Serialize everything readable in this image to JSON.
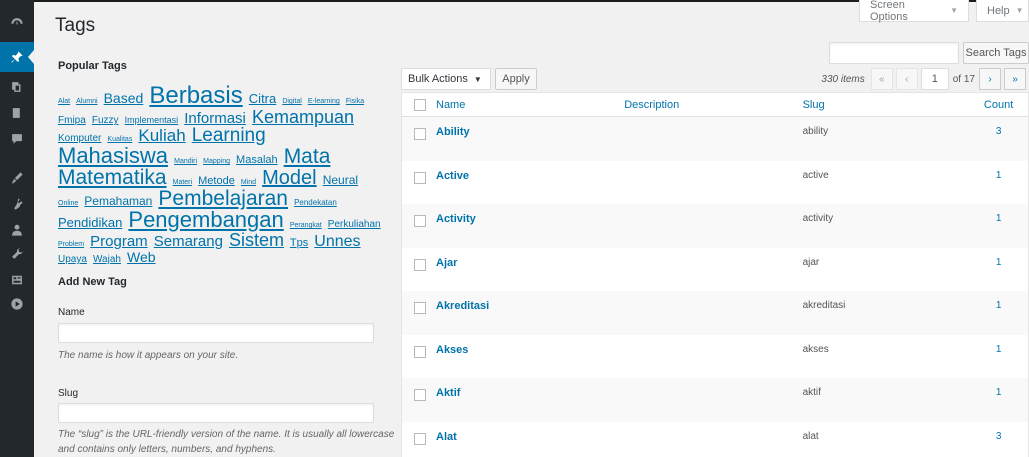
{
  "page_title": "Tags",
  "screen_meta": {
    "screen_options": "Screen Options",
    "help": "Help"
  },
  "search": {
    "button": "Search Tags",
    "value": ""
  },
  "popular_tags": {
    "title": "Popular Tags",
    "tags": [
      {
        "label": "Alat",
        "size": 7
      },
      {
        "label": "Alumni",
        "size": 7
      },
      {
        "label": "Based",
        "size": 14
      },
      {
        "label": "Berbasis",
        "size": 24
      },
      {
        "label": "Citra",
        "size": 13
      },
      {
        "label": "Digital",
        "size": 7
      },
      {
        "label": "E-learning",
        "size": 7
      },
      {
        "label": "Fisika",
        "size": 7
      },
      {
        "label": "Fmipa",
        "size": 10
      },
      {
        "label": "Fuzzy",
        "size": 10
      },
      {
        "label": "Implementasi",
        "size": 9
      },
      {
        "label": "Informasi",
        "size": 15
      },
      {
        "label": "Kemampuan",
        "size": 18
      },
      {
        "label": "Komputer",
        "size": 10
      },
      {
        "label": "Kualitas",
        "size": 7
      },
      {
        "label": "Kuliah",
        "size": 17
      },
      {
        "label": "Learning",
        "size": 19
      },
      {
        "label": "Mahasiswa",
        "size": 22
      },
      {
        "label": "Mandiri",
        "size": 7
      },
      {
        "label": "Mapping",
        "size": 7
      },
      {
        "label": "Masalah",
        "size": 11
      },
      {
        "label": "Mata",
        "size": 21
      },
      {
        "label": "Matematika",
        "size": 21
      },
      {
        "label": "Materi",
        "size": 7
      },
      {
        "label": "Metode",
        "size": 11
      },
      {
        "label": "Mind",
        "size": 7
      },
      {
        "label": "Model",
        "size": 20
      },
      {
        "label": "Neural",
        "size": 12
      },
      {
        "label": "Online",
        "size": 7
      },
      {
        "label": "Pemahaman",
        "size": 12
      },
      {
        "label": "Pembelajaran",
        "size": 21
      },
      {
        "label": "Pendekatan",
        "size": 8
      },
      {
        "label": "Pendidikan",
        "size": 13
      },
      {
        "label": "Pengembangan",
        "size": 22
      },
      {
        "label": "Perangkat",
        "size": 7
      },
      {
        "label": "Perkuliahan",
        "size": 10
      },
      {
        "label": "Problem",
        "size": 7
      },
      {
        "label": "Program",
        "size": 15
      },
      {
        "label": "Semarang",
        "size": 15
      },
      {
        "label": "Sistem",
        "size": 18
      },
      {
        "label": "Tps",
        "size": 11
      },
      {
        "label": "Unnes",
        "size": 16
      },
      {
        "label": "Upaya",
        "size": 10
      },
      {
        "label": "Wajah",
        "size": 10
      },
      {
        "label": "Web",
        "size": 14
      }
    ]
  },
  "add_new": {
    "title": "Add New Tag",
    "name_label": "Name",
    "name_value": "",
    "name_desc": "The name is how it appears on your site.",
    "slug_label": "Slug",
    "slug_value": "",
    "slug_desc": "The “slug” is the URL-friendly version of the name. It is usually all lowercase and contains only letters, numbers, and hyphens."
  },
  "tablenav": {
    "bulk_actions": "Bulk Actions",
    "apply": "Apply",
    "items": "330 items",
    "current_page": "1",
    "total_pages": "of 17",
    "first": "«",
    "prev": "‹",
    "next": "›",
    "last": "»"
  },
  "table": {
    "columns": {
      "name": "Name",
      "description": "Description",
      "slug": "Slug",
      "count": "Count"
    },
    "rows": [
      {
        "name": "Ability",
        "description": "",
        "slug": "ability",
        "count": "3"
      },
      {
        "name": "Active",
        "description": "",
        "slug": "active",
        "count": "1"
      },
      {
        "name": "Activity",
        "description": "",
        "slug": "activity",
        "count": "1"
      },
      {
        "name": "Ajar",
        "description": "",
        "slug": "ajar",
        "count": "1"
      },
      {
        "name": "Akreditasi",
        "description": "",
        "slug": "akreditasi",
        "count": "1"
      },
      {
        "name": "Akses",
        "description": "",
        "slug": "akses",
        "count": "1"
      },
      {
        "name": "Aktif",
        "description": "",
        "slug": "aktif",
        "count": "1"
      },
      {
        "name": "Alat",
        "description": "",
        "slug": "alat",
        "count": "3"
      }
    ]
  },
  "sidebar_icons": [
    "dashboard-icon",
    "pin-icon",
    "media-icon",
    "pages-icon",
    "comments-icon",
    "appearance-icon",
    "plugins-icon",
    "users-icon",
    "tools-icon",
    "settings-icon",
    "video-icon"
  ]
}
